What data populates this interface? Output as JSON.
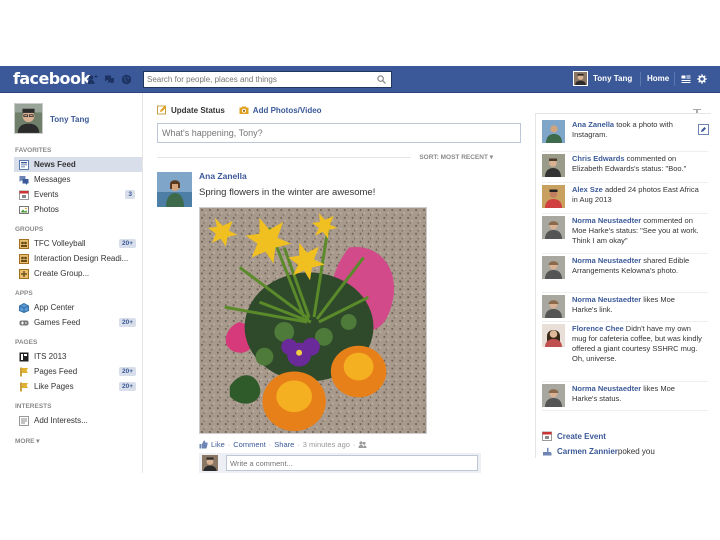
{
  "topbar": {
    "logo": "facebook",
    "search_placeholder": "Search for people, places and things",
    "user_name": "Tony Tang",
    "home_label": "Home",
    "colors": {
      "bar": "#3b5998",
      "link": "#3b5998"
    }
  },
  "profile": {
    "name": "Tony Tang"
  },
  "sidebar": {
    "favorites_label": "FAVORITES",
    "favorites": [
      {
        "label": "News Feed",
        "icon": "news-feed-icon"
      },
      {
        "label": "Messages",
        "icon": "messages-icon"
      },
      {
        "label": "Events",
        "icon": "events-icon",
        "count": "3"
      },
      {
        "label": "Photos",
        "icon": "photos-icon"
      }
    ],
    "groups_label": "GROUPS",
    "groups": [
      {
        "label": "TFC Volleyball",
        "icon": "group-icon",
        "count": "20+"
      },
      {
        "label": "Interaction Design Readi...",
        "icon": "group-icon"
      },
      {
        "label": "Create Group...",
        "icon": "create-group-icon"
      }
    ],
    "apps_label": "APPS",
    "apps": [
      {
        "label": "App Center",
        "icon": "app-center-icon"
      },
      {
        "label": "Games Feed",
        "icon": "games-icon",
        "count": "20+"
      }
    ],
    "pages_label": "PAGES",
    "pages": [
      {
        "label": "ITS 2013",
        "icon": "page-icon"
      },
      {
        "label": "Pages Feed",
        "icon": "pages-feed-icon",
        "count": "20+"
      },
      {
        "label": "Like Pages",
        "icon": "like-pages-icon",
        "count": "20+"
      }
    ],
    "interests_label": "INTERESTS",
    "interests": [
      {
        "label": "Add Interests...",
        "icon": "add-interests-icon"
      }
    ],
    "more_label": "MORE ▾"
  },
  "composer": {
    "update_status": "Update Status",
    "add_photos": "Add Photos/Video",
    "placeholder": "What's happening, Tony?",
    "sort_label": "SORT: MOST RECENT ▾"
  },
  "story": {
    "author": "Ana Zanella",
    "message": "Spring flowers in the winter are awesome!",
    "like": "Like",
    "comment": "Comment",
    "share": "Share",
    "time": "3 minutes ago",
    "comment_placeholder": "Write a comment..."
  },
  "ticker": [
    {
      "name": "Ana Zanella",
      "text": " took a photo with Instagram."
    },
    {
      "name": "Chris Edwards",
      "text": " commented on Elizabeth Edwards's status: \"Boo.\""
    },
    {
      "name": "Alex Sze",
      "text": " added 24 photos East Africa in Aug 2013"
    },
    {
      "name": "Norma Neustaedter",
      "text": " commented on Moe Harke's status: \"See you at work. Think I am okay\""
    },
    {
      "name": "Norma Neustaedter",
      "text": " shared Edible Arrangements Kelowna's photo."
    },
    {
      "name": "Norma Neustaedter",
      "text": " likes Moe Harke's link."
    },
    {
      "name": "Florence Chee",
      "text": " Didn't have my own mug for cafeteria coffee, but was kindly offered a giant courtesy SSHRC mug. Oh, universe."
    },
    {
      "name": "Norma Neustaedter",
      "text": " likes Moe Harke's status."
    }
  ],
  "ticker_footer": {
    "create_event": "Create Event",
    "poke_name": "Carmen Zannier",
    "poke_text": " poked you"
  }
}
